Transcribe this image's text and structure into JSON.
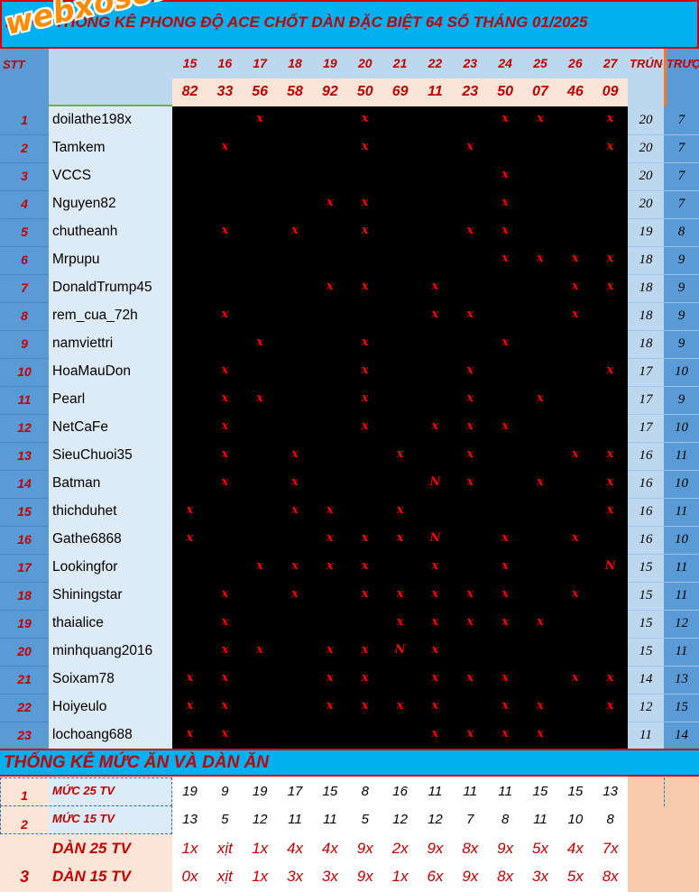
{
  "title": "BẢNG THỐNG KÊ PHONG ĐỘ ACE CHỐT DÀN ĐẶC BIỆT 64 SỐ  THÁNG 01/2025",
  "logo": "webxoso.net",
  "header": {
    "stt_label": "STT",
    "trung_label": "TRÚNG",
    "truot_label": "TRƯỢT",
    "days": [
      "15",
      "16",
      "17",
      "18",
      "19",
      "20",
      "21",
      "22",
      "23",
      "24",
      "25",
      "26",
      "27"
    ],
    "results": [
      "82",
      "33",
      "56",
      "58",
      "92",
      "50",
      "69",
      "11",
      "23",
      "50",
      "07",
      "46",
      "09"
    ]
  },
  "rows": [
    {
      "stt": "1",
      "name": "doilathe198x",
      "marks": [
        "",
        "",
        "x",
        "",
        "",
        "x",
        "",
        "",
        "",
        "x",
        "x",
        "",
        "x"
      ],
      "trung": "20",
      "truot": "7"
    },
    {
      "stt": "2",
      "name": "Tamkem",
      "marks": [
        "",
        "x",
        "",
        "",
        "",
        "x",
        "",
        "",
        "x",
        "",
        "",
        "",
        "x"
      ],
      "trung": "20",
      "truot": "7"
    },
    {
      "stt": "3",
      "name": "VCCS",
      "marks": [
        "",
        "",
        "",
        "",
        "",
        "",
        "",
        "",
        "",
        "x",
        "",
        "",
        ""
      ],
      "trung": "20",
      "truot": "7"
    },
    {
      "stt": "4",
      "name": "Nguyen82",
      "marks": [
        "",
        "",
        "",
        "",
        "x",
        "x",
        "",
        "",
        "",
        "x",
        "",
        "",
        ""
      ],
      "trung": "20",
      "truot": "7"
    },
    {
      "stt": "5",
      "name": "chutheanh",
      "marks": [
        "",
        "x",
        "",
        "x",
        "",
        "x",
        "",
        "",
        "x",
        "x",
        "",
        "",
        ""
      ],
      "trung": "19",
      "truot": "8"
    },
    {
      "stt": "6",
      "name": "Mrpupu",
      "marks": [
        "",
        "",
        "",
        "",
        "",
        "",
        "",
        "",
        "",
        "x",
        "x",
        "x",
        "x"
      ],
      "trung": "18",
      "truot": "9"
    },
    {
      "stt": "7",
      "name": "DonaldTrump45",
      "marks": [
        "",
        "",
        "",
        "",
        "x",
        "x",
        "",
        "x",
        "",
        "",
        "",
        "x",
        "x"
      ],
      "trung": "18",
      "truot": "9"
    },
    {
      "stt": "8",
      "name": "rem_cua_72h",
      "marks": [
        "",
        "x",
        "",
        "",
        "",
        "",
        "",
        "x",
        "x",
        "",
        "",
        "x",
        ""
      ],
      "trung": "18",
      "truot": "9"
    },
    {
      "stt": "9",
      "name": "namviettri",
      "marks": [
        "",
        "",
        "x",
        "",
        "",
        "x",
        "",
        "",
        "",
        "x",
        "",
        "",
        ""
      ],
      "trung": "18",
      "truot": "9"
    },
    {
      "stt": "10",
      "name": "HoaMauDon",
      "marks": [
        "",
        "x",
        "",
        "",
        "",
        "x",
        "",
        "",
        "x",
        "",
        "",
        "",
        "x"
      ],
      "trung": "17",
      "truot": "10"
    },
    {
      "stt": "11",
      "name": "Pearl",
      "marks": [
        "",
        "x",
        "x",
        "",
        "",
        "x",
        "",
        "",
        "x",
        "",
        "x",
        "",
        ""
      ],
      "trung": "17",
      "truot": "9"
    },
    {
      "stt": "12",
      "name": "NetCaFe",
      "marks": [
        "",
        "x",
        "",
        "",
        "",
        "x",
        "",
        "x",
        "x",
        "x",
        "",
        "",
        ""
      ],
      "trung": "17",
      "truot": "10"
    },
    {
      "stt": "13",
      "name": "SieuChuoi35",
      "marks": [
        "",
        "x",
        "",
        "x",
        "",
        "",
        "x",
        "",
        "x",
        "",
        "",
        "x",
        "x"
      ],
      "trung": "16",
      "truot": "11"
    },
    {
      "stt": "14",
      "name": "Batman",
      "marks": [
        "",
        "x",
        "",
        "x",
        "",
        "",
        "",
        "N",
        "x",
        "",
        "x",
        "",
        "x"
      ],
      "trung": "16",
      "truot": "10"
    },
    {
      "stt": "15",
      "name": "thichduhet",
      "marks": [
        "x",
        "",
        "",
        "x",
        "x",
        "",
        "x",
        "",
        "",
        "",
        "",
        "",
        "x"
      ],
      "trung": "16",
      "truot": "11"
    },
    {
      "stt": "16",
      "name": "Gathe6868",
      "marks": [
        "x",
        "",
        "",
        "",
        "x",
        "x",
        "x",
        "N",
        "",
        "x",
        "",
        "x",
        ""
      ],
      "trung": "16",
      "truot": "10"
    },
    {
      "stt": "17",
      "name": "Lookingfor",
      "marks": [
        "",
        "",
        "x",
        "x",
        "x",
        "x",
        "",
        "x",
        "",
        "x",
        "",
        "",
        "N"
      ],
      "trung": "15",
      "truot": "11"
    },
    {
      "stt": "18",
      "name": "Shiningstar",
      "marks": [
        "",
        "x",
        "",
        "x",
        "",
        "x",
        "x",
        "x",
        "x",
        "x",
        "",
        "x",
        ""
      ],
      "trung": "15",
      "truot": "11"
    },
    {
      "stt": "19",
      "name": "thaialice",
      "marks": [
        "",
        "x",
        "",
        "",
        "",
        "",
        "x",
        "x",
        "x",
        "x",
        "x",
        "",
        ""
      ],
      "trung": "15",
      "truot": "12"
    },
    {
      "stt": "20",
      "name": "minhquang2016",
      "marks": [
        "",
        "x",
        "x",
        "",
        "x",
        "x",
        "N",
        "x",
        "",
        "",
        "",
        "",
        ""
      ],
      "trung": "15",
      "truot": "11"
    },
    {
      "stt": "21",
      "name": "Soixam78",
      "marks": [
        "x",
        "x",
        "",
        "",
        "x",
        "x",
        "",
        "x",
        "x",
        "x",
        "",
        "x",
        "x"
      ],
      "trung": "14",
      "truot": "13"
    },
    {
      "stt": "22",
      "name": "Hoiyeulo",
      "marks": [
        "x",
        "x",
        "",
        "",
        "x",
        "x",
        "x",
        "x",
        "",
        "x",
        "x",
        "",
        "x"
      ],
      "trung": "12",
      "truot": "15"
    },
    {
      "stt": "23",
      "name": "lochoang688",
      "marks": [
        "x",
        "x",
        "",
        "",
        "",
        "",
        "",
        "x",
        "x",
        "x",
        "x",
        "",
        ""
      ],
      "trung": "11",
      "truot": "14"
    }
  ],
  "stats": {
    "title": "THỐNG KÊ MỨC ĂN VÀ DÀN ĂN",
    "stt": [
      "1",
      "2",
      "3"
    ],
    "muc25_label": "MỨC 25 TV",
    "muc15_label": "MỨC 15 TV",
    "dan25_label": "DÀN  25 TV",
    "dan15_label": "DÀN 15 TV",
    "muc25": [
      "19",
      "9",
      "19",
      "17",
      "15",
      "8",
      "16",
      "11",
      "11",
      "11",
      "15",
      "15",
      "13"
    ],
    "muc15": [
      "13",
      "5",
      "12",
      "11",
      "11",
      "5",
      "12",
      "12",
      "7",
      "8",
      "11",
      "10",
      "8"
    ],
    "dan25": [
      "1x",
      "xịt",
      "1x",
      "4x",
      "4x",
      "9x",
      "2x",
      "9x",
      "8x",
      "9x",
      "5x",
      "4x",
      "7x"
    ],
    "dan15": [
      "0x",
      "xịt",
      "1x",
      "3x",
      "3x",
      "9x",
      "1x",
      "6x",
      "9x",
      "8x",
      "3x",
      "5x",
      "8x"
    ]
  },
  "colors": {
    "accent_red": "#c00000",
    "mark_red": "#ff0000",
    "title_blue": "#00b0f0",
    "stt_blue": "#5b9bd5",
    "light_blue": "#bdd7ee",
    "peach": "#fce4d6",
    "logo_orange": "#ff8c00"
  }
}
